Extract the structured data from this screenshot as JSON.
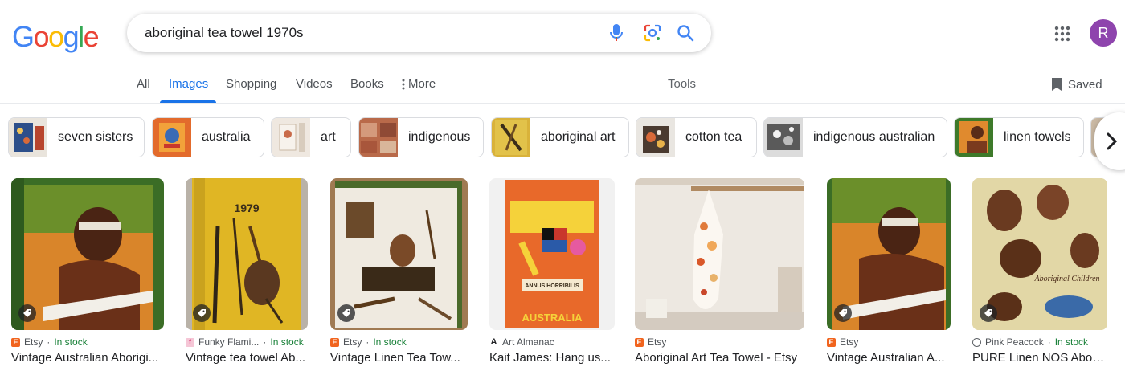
{
  "logo": {
    "letters": [
      "G",
      "o",
      "o",
      "g",
      "l",
      "e"
    ],
    "colors": [
      "#4285F4",
      "#EA4335",
      "#FBBC05",
      "#4285F4",
      "#34A853",
      "#EA4335"
    ]
  },
  "search": {
    "query": "aboriginal tea towel 1970s"
  },
  "header": {
    "avatar_letter": "R",
    "avatar_color": "#8e44ad"
  },
  "tabs": {
    "items": [
      {
        "label": "All"
      },
      {
        "label": "Images"
      },
      {
        "label": "Shopping"
      },
      {
        "label": "Videos"
      },
      {
        "label": "Books"
      },
      {
        "label": "More"
      }
    ],
    "active": "Images",
    "tools": "Tools",
    "saved": "Saved"
  },
  "chips": [
    {
      "label": "seven sisters"
    },
    {
      "label": "australia"
    },
    {
      "label": "art"
    },
    {
      "label": "indigenous"
    },
    {
      "label": "aboriginal art"
    },
    {
      "label": "cotton tea"
    },
    {
      "label": "indigenous australian"
    },
    {
      "label": "linen towels"
    }
  ],
  "results": [
    {
      "source": "Etsy",
      "stock": "In stock",
      "title": "Vintage Australian Aborigi..."
    },
    {
      "source": "Funky Flami...",
      "stock": "In stock",
      "title": "Vintage tea towel Ab..."
    },
    {
      "source": "Etsy",
      "stock": "In stock",
      "title": "Vintage Linen Tea Tow..."
    },
    {
      "source": "Art Almanac",
      "stock": "",
      "title": "Kait James: Hang us..."
    },
    {
      "source": "Etsy",
      "stock": "",
      "title": "Aboriginal Art Tea Towel - Etsy"
    },
    {
      "source": "Etsy",
      "stock": "",
      "title": "Vintage Australian A..."
    },
    {
      "source": "Pink Peacock",
      "stock": "In stock",
      "title": "PURE Linen NOS Abori..."
    }
  ],
  "results_text": {
    "separator": " · "
  },
  "images": {
    "thumb_text_1": "1979",
    "thumb_text_2": "ANNUS HORRIBILIS",
    "thumb_text_3": "AUSTRALIA",
    "thumb_text_4": "Aboriginal Children"
  },
  "colors": {
    "accent": "#1a73e8",
    "stock_green": "#188038",
    "etsy_orange": "#F1641E"
  }
}
